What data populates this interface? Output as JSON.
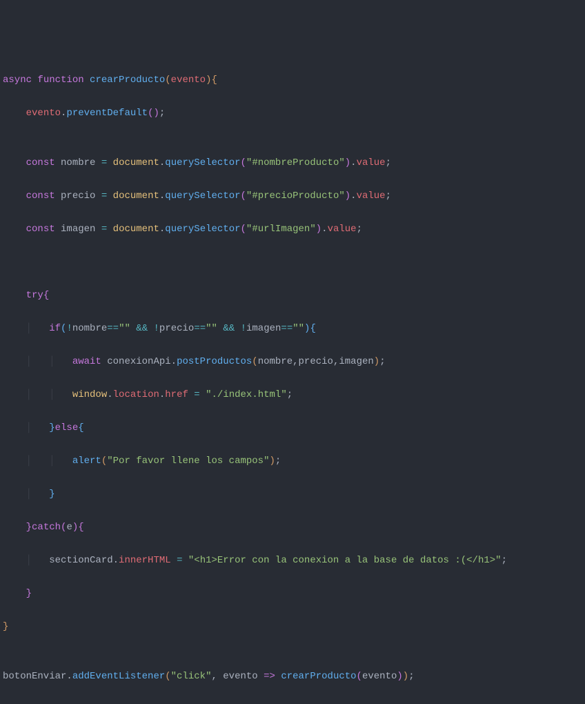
{
  "code": {
    "line1": {
      "async": "async",
      "function": "function",
      "name": "crearProducto",
      "param": "evento"
    },
    "line2": {
      "var": "evento",
      "method": "preventDefault"
    },
    "line4": {
      "const": "const",
      "name": "nombre",
      "eq": "=",
      "obj": "document",
      "method": "querySelector",
      "arg": "\"#nombreProducto\"",
      "prop": "value"
    },
    "line5": {
      "const": "const",
      "name": "precio",
      "eq": "=",
      "obj": "document",
      "method": "querySelector",
      "arg": "\"#precioProducto\"",
      "prop": "value"
    },
    "line6": {
      "const": "const",
      "name": "imagen",
      "eq": "=",
      "obj": "document",
      "method": "querySelector",
      "arg": "\"#urlImagen\"",
      "prop": "value"
    },
    "line9": {
      "try": "try"
    },
    "line10": {
      "if": "if",
      "not1": "!",
      "var1": "nombre",
      "eq1": "==",
      "empty1": "\"\"",
      "and1": "&&",
      "not2": "!",
      "var2": "precio",
      "eq2": "==",
      "empty2": "\"\"",
      "and2": "&&",
      "not3": "!",
      "var3": "imagen",
      "eq3": "==",
      "empty3": "\"\""
    },
    "line11": {
      "await": "await",
      "obj": "conexionApi",
      "method": "postProductos",
      "arg1": "nombre",
      "arg2": "precio",
      "arg3": "imagen"
    },
    "line12": {
      "obj": "window",
      "prop": "location",
      "prop2": "href",
      "eq": "=",
      "val": "\"./index.html\""
    },
    "line13": {
      "else": "else"
    },
    "line14": {
      "fn": "alert",
      "arg": "\"Por favor llene los campos\""
    },
    "line16": {
      "catch": "catch",
      "param": "e"
    },
    "line17": {
      "obj": "sectionCard",
      "prop": "innerHTML",
      "eq": "=",
      "val": "\"<h1>Error con la conexion a la base de datos :(</h1>\""
    },
    "line21": {
      "obj": "botonEnviar",
      "method": "addEventListener",
      "arg1": "\"click\"",
      "param": "evento",
      "arrow": "=>",
      "fn": "crearProducto",
      "arg2": "evento"
    }
  }
}
